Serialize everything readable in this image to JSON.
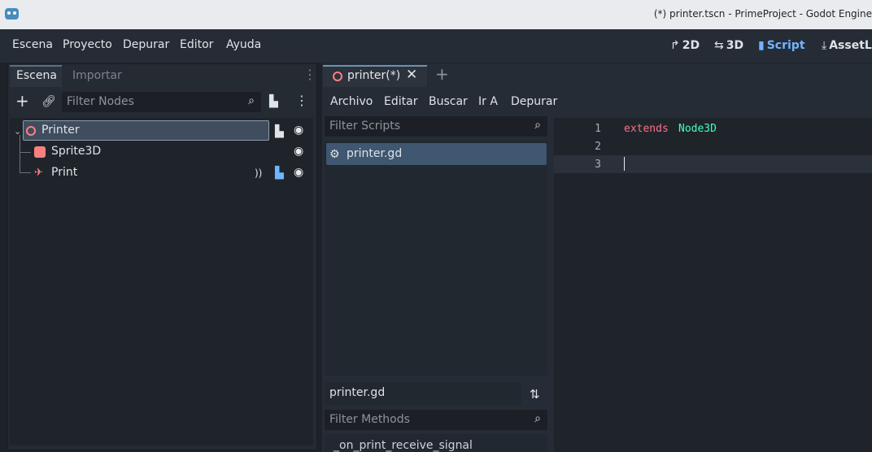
{
  "window": {
    "title": "(*) printer.tscn - PrimeProject - Godot Engine"
  },
  "menubar": {
    "items": [
      "Escena",
      "Proyecto",
      "Depurar",
      "Editor",
      "Ayuda"
    ],
    "workspaces": [
      {
        "icon": "2d-icon",
        "label": "2D"
      },
      {
        "icon": "3d-icon",
        "label": "3D"
      },
      {
        "icon": "script-icon",
        "label": "Script",
        "active": true
      },
      {
        "icon": "assetlib-icon",
        "label": "AssetLib"
      }
    ]
  },
  "scene_dock": {
    "tabs": [
      "Escena",
      "Importar"
    ],
    "filter_placeholder": "Filter Nodes",
    "nodes": [
      {
        "label": "Printer",
        "type": "node3d-icon",
        "has_script": true,
        "selected": true
      },
      {
        "label": "Sprite3D",
        "type": "sprite3d-icon"
      },
      {
        "label": "Print",
        "type": "audio-listener-icon",
        "has_signal": true,
        "has_script": true
      }
    ]
  },
  "script_editor": {
    "open_tab": "printer(*)",
    "menu": [
      "Archivo",
      "Editar",
      "Buscar",
      "Ir A",
      "Depurar"
    ],
    "filter_scripts_placeholder": "Filter Scripts",
    "scripts": [
      "printer.gd"
    ],
    "current_script": "printer.gd",
    "filter_methods_placeholder": "Filter Methods",
    "methods": [
      "_on_print_receive_signal"
    ],
    "code": {
      "lines": [
        {
          "number": "1",
          "keyword": "extends",
          "type": "Node3D"
        },
        {
          "number": "2",
          "keyword": "",
          "type": ""
        },
        {
          "number": "3",
          "keyword": "",
          "type": ""
        }
      ]
    }
  },
  "colors": {
    "accent": "#70b5ff",
    "keyword": "#ff7085",
    "type": "#42ffc2",
    "node3d": "#fc7f7f"
  }
}
